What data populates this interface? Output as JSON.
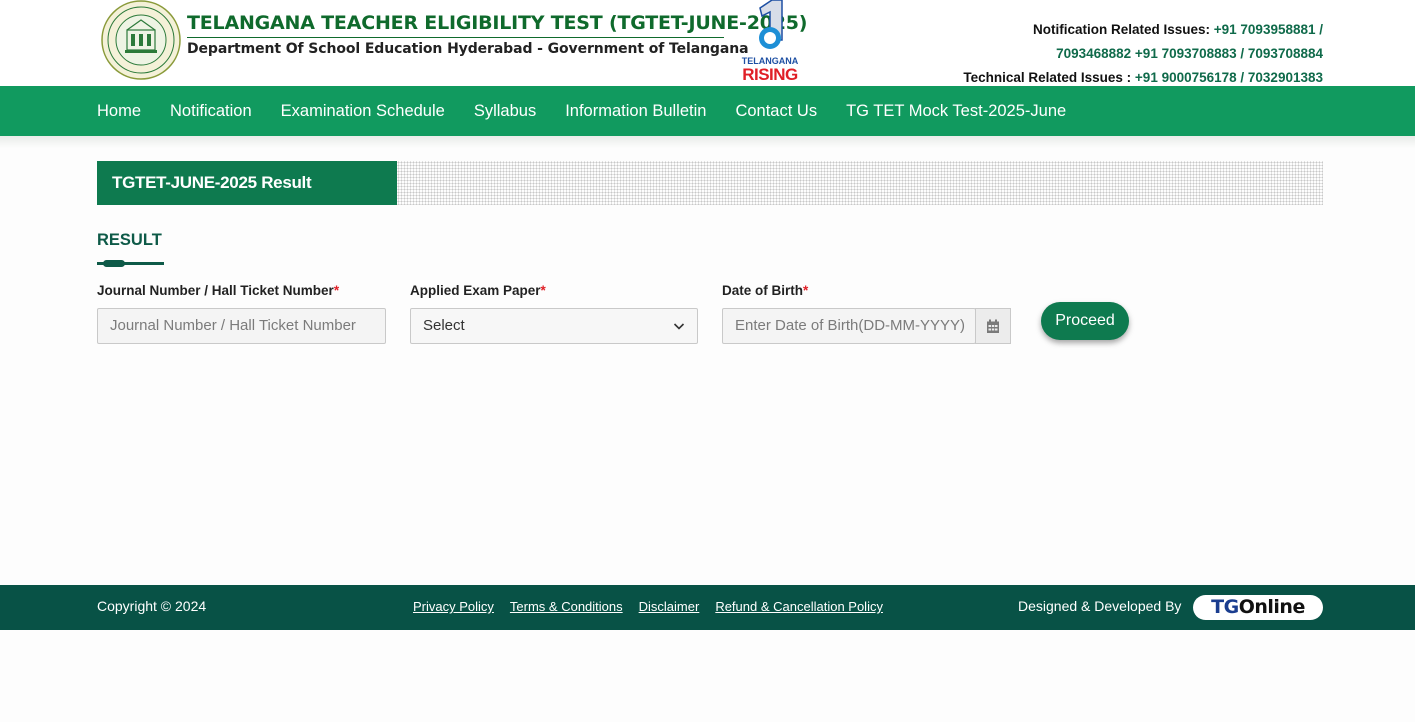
{
  "header": {
    "title": "TELANGANA TEACHER ELIGIBILITY TEST (TGTET-JUNE-2025)",
    "subtitle": "Department Of School Education Hyderabad - Government of Telangana",
    "emblem_icon": "government-of-telangana-emblem-icon",
    "rising_logo": {
      "line1": "TELANGANA",
      "line2": "RISING"
    },
    "contacts": {
      "notification_label": "Notification Related Issues:",
      "notification_numbers_1": "+91 7093958881 /",
      "notification_numbers_2": "7093468882 +91 7093708883 / 7093708884",
      "technical_label": "Technical Related Issues :",
      "technical_numbers": "+91 9000756178 / 7032901383"
    }
  },
  "nav": {
    "items": [
      "Home",
      "Notification",
      "Examination Schedule",
      "Syllabus",
      "Information Bulletin",
      "Contact Us",
      "TG TET Mock Test-2025-June"
    ]
  },
  "section": {
    "heading": "TGTET-JUNE-2025 Result",
    "result_title": "RESULT"
  },
  "form": {
    "journal": {
      "label": "Journal Number / Hall Ticket Number",
      "required_mark": "*",
      "placeholder": "Journal Number / Hall Ticket Number"
    },
    "paper": {
      "label": "Applied Exam Paper",
      "required_mark": "*",
      "selected": "Select"
    },
    "dob": {
      "label": "Date of Birth",
      "required_mark": "*",
      "placeholder": "Enter Date of Birth(DD-MM-YYYY)",
      "icon": "calendar-icon"
    },
    "proceed_label": "Proceed"
  },
  "footer": {
    "copyright": "Copyright © 2024",
    "links": [
      "Privacy Policy",
      "Terms & Conditions",
      "Disclaimer",
      "Refund & Cancellation Policy"
    ],
    "designed_by": "Designed & Developed By",
    "brand": {
      "part1": "TG",
      "part2": "Online"
    }
  },
  "colors": {
    "nav_green": "#119a5f",
    "heading_green": "#0e7a4f",
    "footer_green": "#085246",
    "title_green": "#0f6a2c",
    "required_red": "#e01f26"
  }
}
